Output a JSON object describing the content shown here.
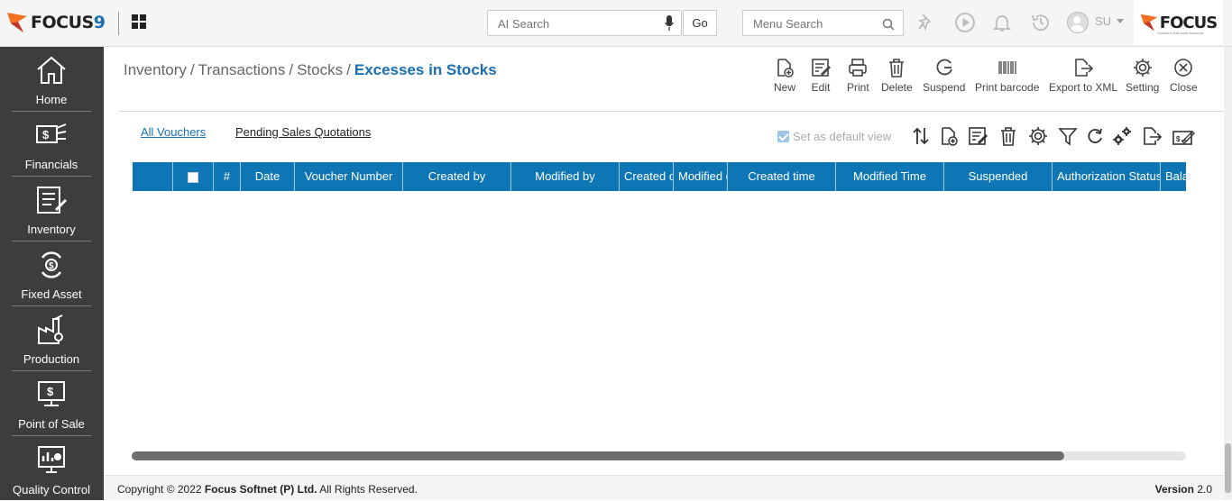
{
  "header": {
    "logo_text": "FOCUS",
    "logo_number": "9",
    "ai_search_placeholder": "AI Search",
    "go_label": "Go",
    "menu_search_placeholder": "Menu Search",
    "user_initials": "SU",
    "brand_text": "FOCUS",
    "brand_tagline": "Solutions that scale business"
  },
  "sidebar": {
    "items": [
      {
        "label": "Home",
        "icon": "home-icon"
      },
      {
        "label": "Financials",
        "icon": "financials-icon"
      },
      {
        "label": "Inventory",
        "icon": "inventory-icon"
      },
      {
        "label": "Fixed Asset",
        "icon": "fixed-asset-icon"
      },
      {
        "label": "Production",
        "icon": "production-icon"
      },
      {
        "label": "Point of Sale",
        "icon": "point-of-sale-icon"
      },
      {
        "label": "Quality Control",
        "icon": "quality-control-icon"
      }
    ]
  },
  "breadcrumb": {
    "items": [
      "Inventory",
      "Transactions",
      "Stocks"
    ],
    "separator": "/",
    "current": "Excesses in Stocks"
  },
  "toolbar": {
    "new": "New",
    "edit": "Edit",
    "print": "Print",
    "delete": "Delete",
    "suspend": "Suspend",
    "print_barcode": "Print barcode",
    "export_xml": "Export to XML",
    "setting": "Setting",
    "close": "Close"
  },
  "tabs": {
    "all_vouchers": "All Vouchers",
    "pending_sales_quotations": "Pending Sales Quotations"
  },
  "default_view_label": "Set as default view",
  "table": {
    "columns": [
      "#",
      "Date",
      "Voucher Number",
      "Created by",
      "Modified by",
      "Created date",
      "Modified date",
      "Created time",
      "Modified Time",
      "Suspended",
      "Authorization Status",
      "Balance"
    ]
  },
  "footer": {
    "copyright_prefix": "Copyright © 2022 ",
    "company": "Focus Softnet (P) Ltd.",
    "rights": " All Rights Reserved.",
    "version_label": "Version",
    "version_value": "2.0"
  },
  "colors": {
    "accent": "#1a6fb3",
    "table_header": "#0e76b4",
    "sidebar_bg": "#3d3d3d"
  }
}
